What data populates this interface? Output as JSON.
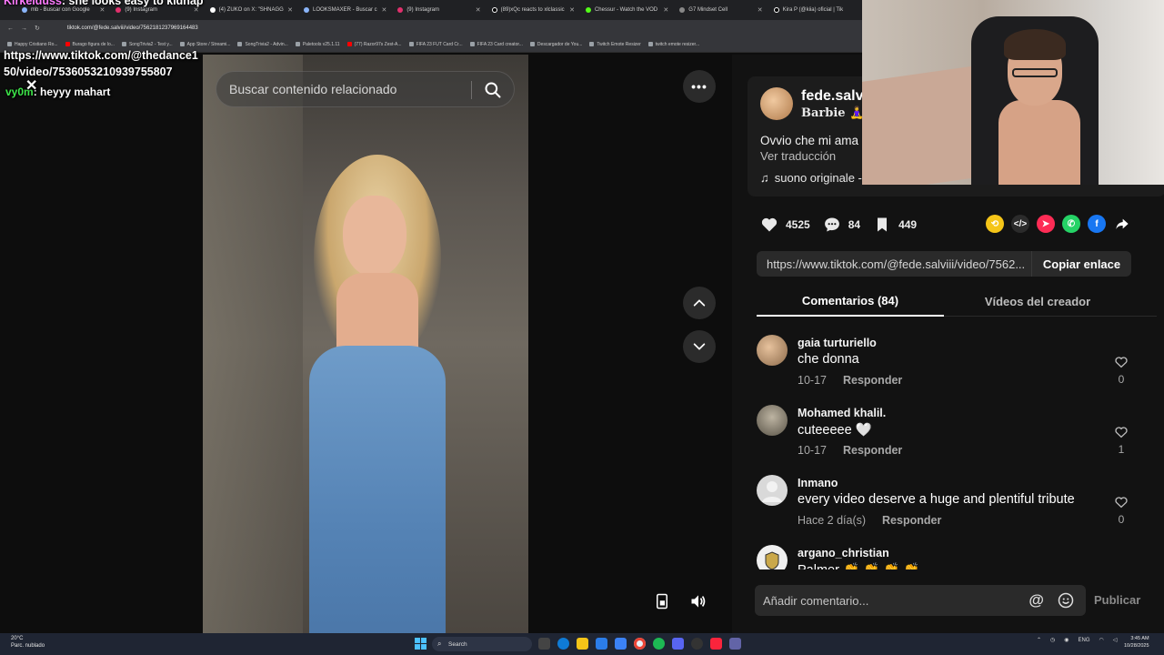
{
  "browser": {
    "tabs": [
      {
        "label": "mb - Buscar con Google"
      },
      {
        "label": "(9) Instagram"
      },
      {
        "label": "(4) ZUKO on X: \"SHNAGG"
      },
      {
        "label": "LOOKSMAXER - Buscar c"
      },
      {
        "label": "(9) Instagram"
      },
      {
        "label": "(89)xQc reacts to xlclassic"
      },
      {
        "label": "Chessur - Watch the VOD"
      },
      {
        "label": "G7 Mindset Cell"
      },
      {
        "label": "Kira P (@kiia) oficial | Tik"
      }
    ],
    "address": "tiktok.com/@fede.salviii/video/7562181237969164483",
    "bookmarks": [
      "Happy Cristiano Ro...",
      "Burago figura de lo...",
      "SongTrivia2 - Test y...",
      "App Store / Streami...",
      "SongTrivia2 - Advin...",
      "Paletools v25.1.11",
      "(77) Razor97s Zest-A...",
      "FIFA 23 FUT Card Cr...",
      "FIFA 23 Card creator...",
      "Descargador de You...",
      "Twitch Emote Resizer",
      "twitch emote resizer..."
    ]
  },
  "chat": {
    "top_user": "Kirkelduss",
    "top_text": ": she looks easy to kidnap",
    "link": "https://www.tiktok.com/@thedance150/video/7536053210939755807",
    "msg_nick": "vy0m",
    "msg_text": ": heyyy mahart"
  },
  "video": {
    "search_placeholder": "Buscar contenido relacionado",
    "more_label": "•••"
  },
  "post": {
    "author": "fede.salvi",
    "subtitle": "Barbie 🧘‍♀️ ·",
    "caption": "Ovvio che mi ama",
    "translate": "Ver traducción",
    "sound": "suono originale -",
    "likes": "4525",
    "comments_count": "84",
    "saves": "449",
    "link": "https://www.tiktok.com/@fede.salviii/video/7562...",
    "copy_label": "Copiar enlace"
  },
  "tabs": {
    "comments": "Comentarios (84)",
    "creator": "Vídeos del creador"
  },
  "comments": [
    {
      "user": "gaia turturiello",
      "text": "che donna",
      "date": "10-17",
      "reply": "Responder",
      "likes": "0",
      "avatar_color": "#b5906c"
    },
    {
      "user": "Mohamed khalil.",
      "text": "cuteeeee 🤍",
      "date": "10-17",
      "reply": "Responder",
      "likes": "1",
      "avatar_color": "#8d8576"
    },
    {
      "user": "Inmano",
      "text": "every video deserve a huge and plentiful tribute",
      "date": "Hace 2 día(s)",
      "reply": "Responder",
      "likes": "0",
      "avatar_color": "#d9d9d9"
    },
    {
      "user": "argano_christian",
      "text": "Palmer 👏 👏 👏 👏",
      "date": "",
      "reply": "",
      "likes": "",
      "avatar_color": "#e8e8e8"
    }
  ],
  "comment_input": {
    "placeholder": "Añadir comentario...",
    "publish": "Publicar"
  },
  "taskbar": {
    "weather_temp": "20°C",
    "weather_desc": "Parc. nublado",
    "search": "Search",
    "lang": "ENG",
    "time": "3:45 AM",
    "date": "10/28/2025"
  },
  "colors": {
    "background": "#121212",
    "accent": "#fe2c55",
    "chat_nick": "#3ee84a"
  }
}
